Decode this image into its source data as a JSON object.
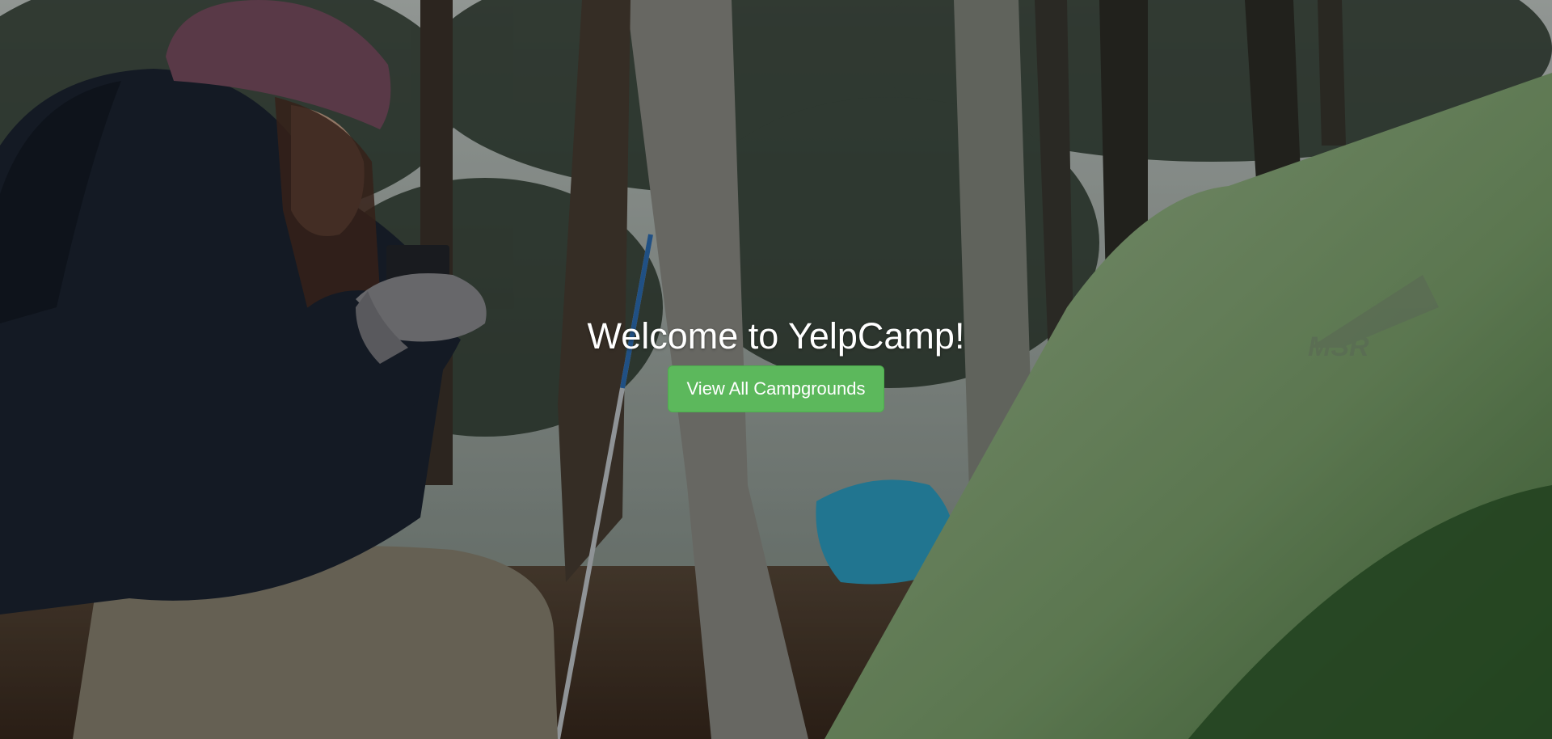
{
  "hero": {
    "heading": "Welcome to YelpCamp!",
    "cta_label": "View All Campgrounds",
    "tent_logo_text": "MSR"
  },
  "colors": {
    "cta_background": "#5cb85c",
    "cta_text": "#ffffff",
    "heading_text": "#ffffff",
    "tent": "#6f9a62"
  }
}
